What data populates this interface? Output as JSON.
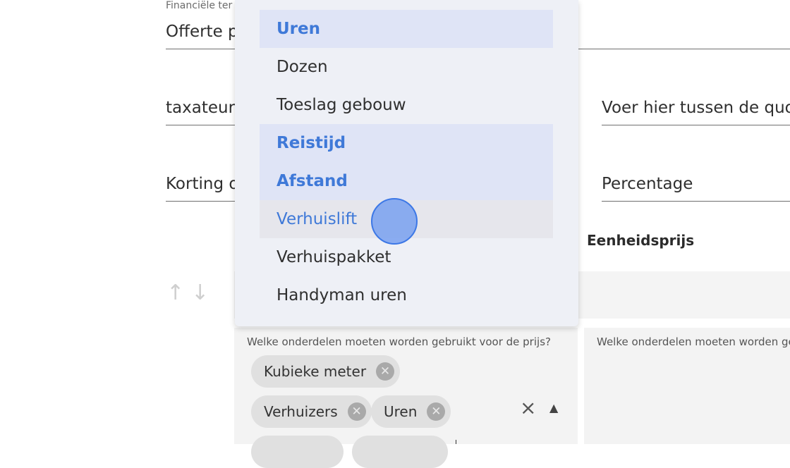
{
  "form": {
    "financial_caption": "Financiële ter",
    "quote_field": "Offerte p",
    "taxateur_field": "taxateur",
    "quote_right_field": "Voer hier tussen de quo",
    "korting_field": "Korting o",
    "percentage_field": "Percentage",
    "unit_price_header": "Eenheidsprijs"
  },
  "dropdown": {
    "items": [
      {
        "label": "Uren",
        "state": "selected"
      },
      {
        "label": "Dozen",
        "state": "normal"
      },
      {
        "label": "Toeslag gebouw",
        "state": "normal"
      },
      {
        "label": "Reistijd",
        "state": "selected"
      },
      {
        "label": "Afstand",
        "state": "selected"
      },
      {
        "label": "Verhuislift",
        "state": "hovered"
      },
      {
        "label": "Verhuispakket",
        "state": "normal"
      },
      {
        "label": "Handyman uren",
        "state": "normal"
      }
    ]
  },
  "price_parts": {
    "question_left": "Welke onderdelen moeten worden gebruikt voor de prijs?",
    "question_right": "Welke onderdelen moeten worden geb",
    "chips": [
      "Kubieke meter",
      "Verhuizers",
      "Uren"
    ],
    "clear_icon": "×",
    "toggle_icon": "▲"
  },
  "reorder": {
    "up_icon": "↑",
    "down_icon": "↓"
  }
}
